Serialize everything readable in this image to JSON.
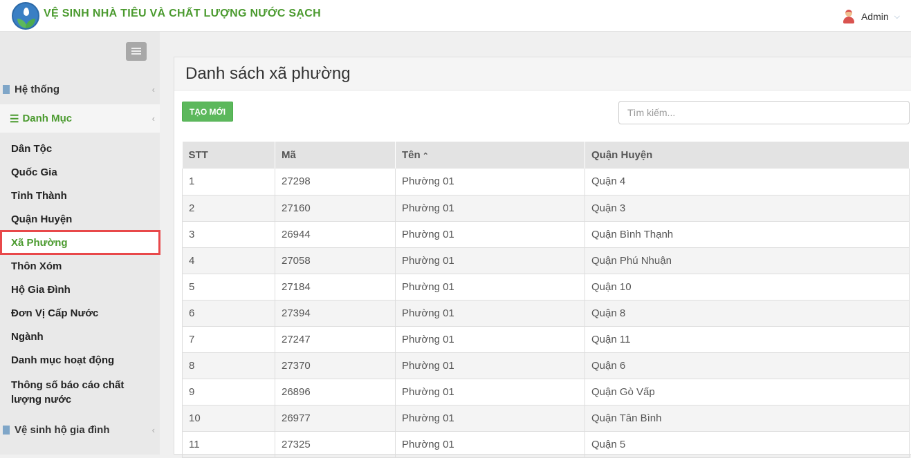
{
  "header": {
    "title": "VỆ SINH NHÀ TIÊU VÀ CHẤT LƯỢNG NƯỚC SẠCH",
    "user": "Admin",
    "user_caret": "⌵"
  },
  "sidebar": {
    "sections": [
      {
        "label": "Hệ thống",
        "caret": "‹"
      },
      {
        "label": "Danh Mục",
        "caret": "‹",
        "icon_glyph": "☰"
      },
      {
        "label": "Vệ sinh hộ gia đình",
        "caret": "‹"
      }
    ],
    "items": [
      {
        "label": "Dân Tộc"
      },
      {
        "label": "Quốc Gia"
      },
      {
        "label": "Tỉnh Thành"
      },
      {
        "label": "Quận Huyện"
      },
      {
        "label": "Xã Phường"
      },
      {
        "label": "Thôn Xóm"
      },
      {
        "label": "Hộ Gia Đình"
      },
      {
        "label": "Đơn Vị Cấp Nước"
      },
      {
        "label": "Ngành"
      },
      {
        "label": "Danh mục hoạt động"
      },
      {
        "label": "Thông số báo cáo chất lượng nước"
      }
    ]
  },
  "main": {
    "title": "Danh sách xã phường",
    "new_button": "TẠO MỚI",
    "search_placeholder": "Tìm kiếm...",
    "sort_glyph": "⌃",
    "columns": [
      "STT",
      "Mã",
      "Tên",
      "Quận Huyện"
    ],
    "rows": [
      [
        "1",
        "27298",
        "Phường 01",
        "Quận 4"
      ],
      [
        "2",
        "27160",
        "Phường 01",
        "Quận 3"
      ],
      [
        "3",
        "26944",
        "Phường 01",
        "Quận Bình Thạnh"
      ],
      [
        "4",
        "27058",
        "Phường 01",
        "Quận Phú Nhuận"
      ],
      [
        "5",
        "27184",
        "Phường 01",
        "Quận 10"
      ],
      [
        "6",
        "27394",
        "Phường 01",
        "Quận 8"
      ],
      [
        "7",
        "27247",
        "Phường 01",
        "Quận 11"
      ],
      [
        "8",
        "27370",
        "Phường 01",
        "Quận 6"
      ],
      [
        "9",
        "26896",
        "Phường 01",
        "Quận Gò Vấp"
      ],
      [
        "10",
        "26977",
        "Phường 01",
        "Quận Tân Bình"
      ],
      [
        "11",
        "27325",
        "Phường 01",
        "Quận 5"
      ]
    ]
  }
}
